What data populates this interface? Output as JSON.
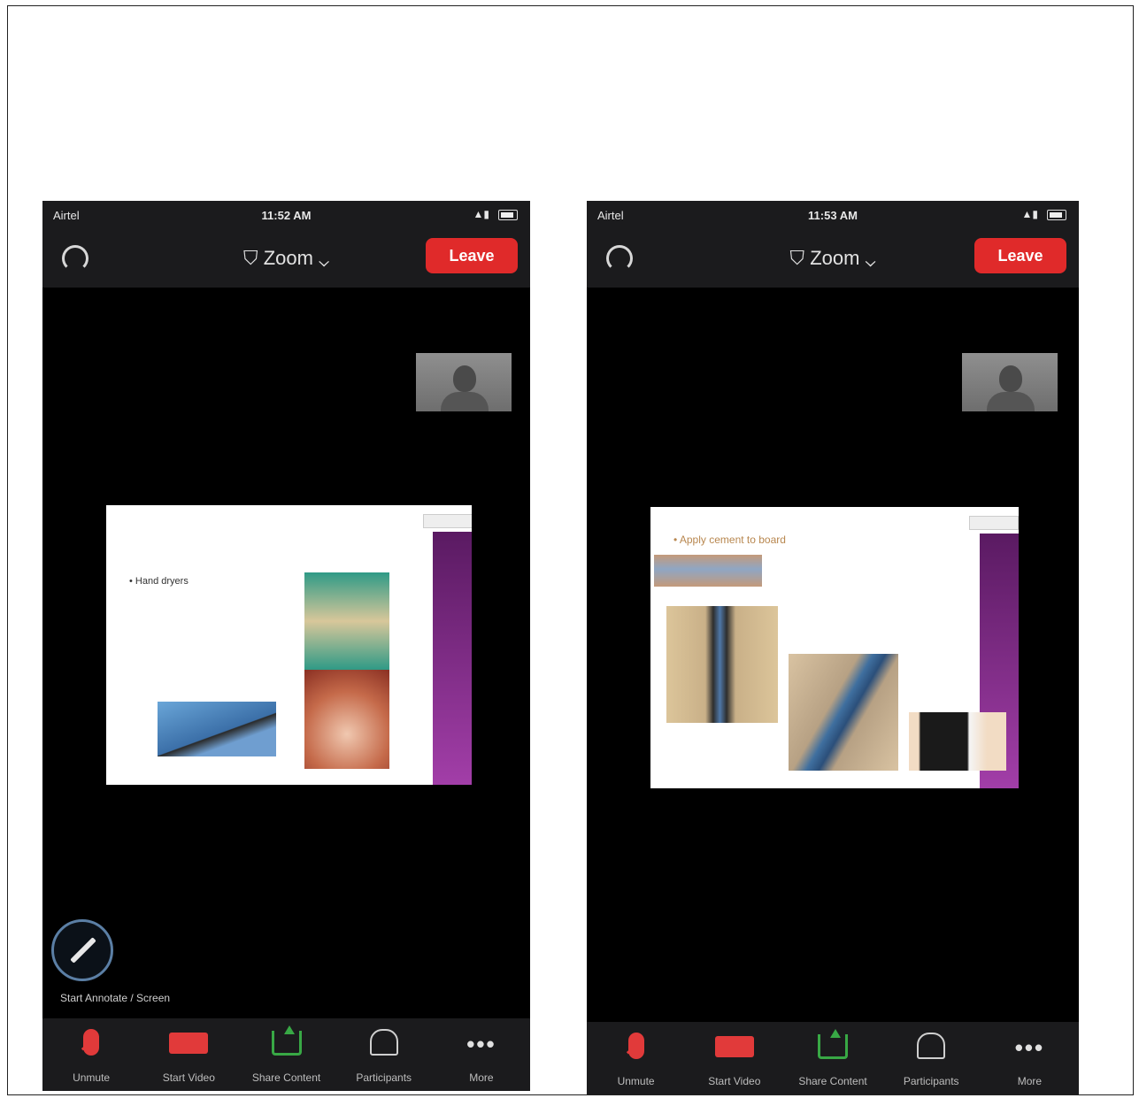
{
  "phones": [
    {
      "status": {
        "carrier": "Airtel",
        "time": "11:52 AM"
      },
      "meeting_title": "Zoom",
      "leave_label": "Leave",
      "slide": {
        "heading": "",
        "text": "• Hand dryers"
      },
      "annotate_caption": "Start Annotate / Screen",
      "toolbar": [
        "Unmute",
        "Start Video",
        "Share Content",
        "Participants",
        "More"
      ]
    },
    {
      "status": {
        "carrier": "Airtel",
        "time": "11:53 AM"
      },
      "meeting_title": "Zoom",
      "leave_label": "Leave",
      "slide": {
        "heading": "• Apply cement to board",
        "text": ""
      },
      "toolbar": [
        "Unmute",
        "Start Video",
        "Share Content",
        "Participants",
        "More"
      ]
    }
  ],
  "colors": {
    "leave": "#e02a2a",
    "toolbar_red": "#e13a3a",
    "share_green": "#38a845",
    "slide_purple": "#8e2f96"
  }
}
